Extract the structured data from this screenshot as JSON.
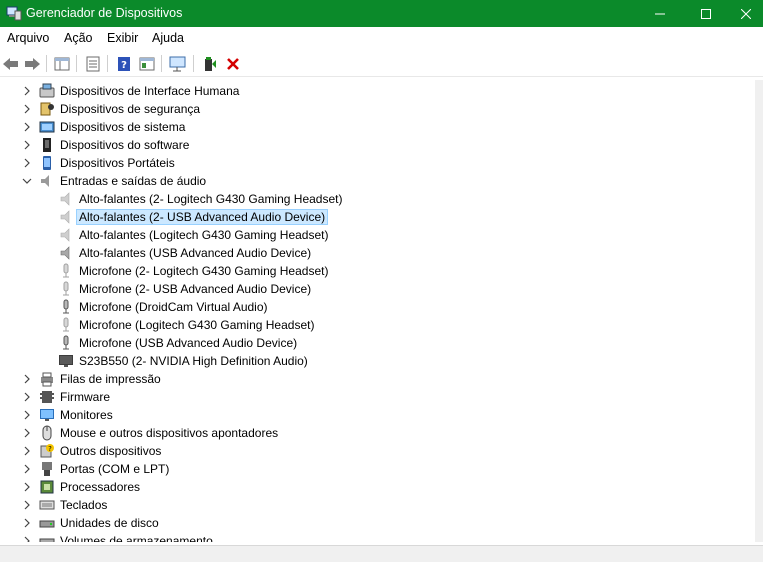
{
  "window": {
    "title": "Gerenciador de Dispositivos",
    "titlebar_color": "#0b8a2a"
  },
  "menu": [
    "Arquivo",
    "Ação",
    "Exibir",
    "Ajuda"
  ],
  "toolbar": {
    "buttons": [
      "back-icon",
      "forward-icon",
      "properties-view-icon",
      "list-icon",
      "help-icon",
      "update-driver-icon",
      "scan-hardware-icon",
      "enable-device-icon",
      "uninstall-device-icon"
    ],
    "uninstall_color": "#d40000"
  },
  "tree": [
    {
      "label": "Dispositivos de Interface Humana",
      "expandable": true,
      "icon": "hid-icon"
    },
    {
      "label": "Dispositivos de segurança",
      "expandable": true,
      "icon": "security-device-icon"
    },
    {
      "label": "Dispositivos de sistema",
      "expandable": true,
      "icon": "system-device-icon"
    },
    {
      "label": "Dispositivos do software",
      "expandable": true,
      "icon": "software-device-icon"
    },
    {
      "label": "Dispositivos Portáteis",
      "expandable": true,
      "icon": "portable-device-icon"
    },
    {
      "label": "Entradas e saídas de áudio",
      "expandable": true,
      "expanded": true,
      "icon": "audio-io-icon"
    },
    {
      "label": "Alto-falantes (2- Logitech G430 Gaming Headset)",
      "child": true,
      "icon": "speaker-icon",
      "disabled_icon": true
    },
    {
      "label": "Alto-falantes (2- USB Advanced Audio Device)",
      "child": true,
      "icon": "speaker-icon",
      "selected": true,
      "disabled_icon": true
    },
    {
      "label": "Alto-falantes (Logitech G430 Gaming Headset)",
      "child": true,
      "icon": "speaker-icon",
      "disabled_icon": true
    },
    {
      "label": "Alto-falantes (USB Advanced Audio Device)",
      "child": true,
      "icon": "speaker-icon"
    },
    {
      "label": "Microfone (2- Logitech G430 Gaming Headset)",
      "child": true,
      "icon": "microphone-icon",
      "disabled_icon": true
    },
    {
      "label": "Microfone (2- USB Advanced Audio Device)",
      "child": true,
      "icon": "microphone-icon",
      "disabled_icon": true
    },
    {
      "label": "Microfone (DroidCam Virtual Audio)",
      "child": true,
      "icon": "microphone-icon"
    },
    {
      "label": "Microfone (Logitech G430 Gaming Headset)",
      "child": true,
      "icon": "microphone-icon",
      "disabled_icon": true
    },
    {
      "label": "Microfone (USB Advanced Audio Device)",
      "child": true,
      "icon": "microphone-icon"
    },
    {
      "label": "S23B550 (2- NVIDIA High Definition Audio)",
      "child": true,
      "icon": "monitor-audio-icon"
    },
    {
      "label": "Filas de impressão",
      "expandable": true,
      "icon": "printer-icon"
    },
    {
      "label": "Firmware",
      "expandable": true,
      "icon": "firmware-icon"
    },
    {
      "label": "Monitores",
      "expandable": true,
      "icon": "monitor-icon"
    },
    {
      "label": "Mouse e outros dispositivos apontadores",
      "expandable": true,
      "icon": "mouse-icon"
    },
    {
      "label": "Outros dispositivos",
      "expandable": true,
      "icon": "other-device-icon"
    },
    {
      "label": "Portas (COM e LPT)",
      "expandable": true,
      "icon": "port-icon"
    },
    {
      "label": "Processadores",
      "expandable": true,
      "icon": "processor-icon"
    },
    {
      "label": "Teclados",
      "expandable": true,
      "icon": "keyboard-icon"
    },
    {
      "label": "Unidades de disco",
      "expandable": true,
      "icon": "disk-icon"
    },
    {
      "label": "Volumes de armazenamento",
      "expandable": true,
      "icon": "storage-volume-icon"
    }
  ]
}
